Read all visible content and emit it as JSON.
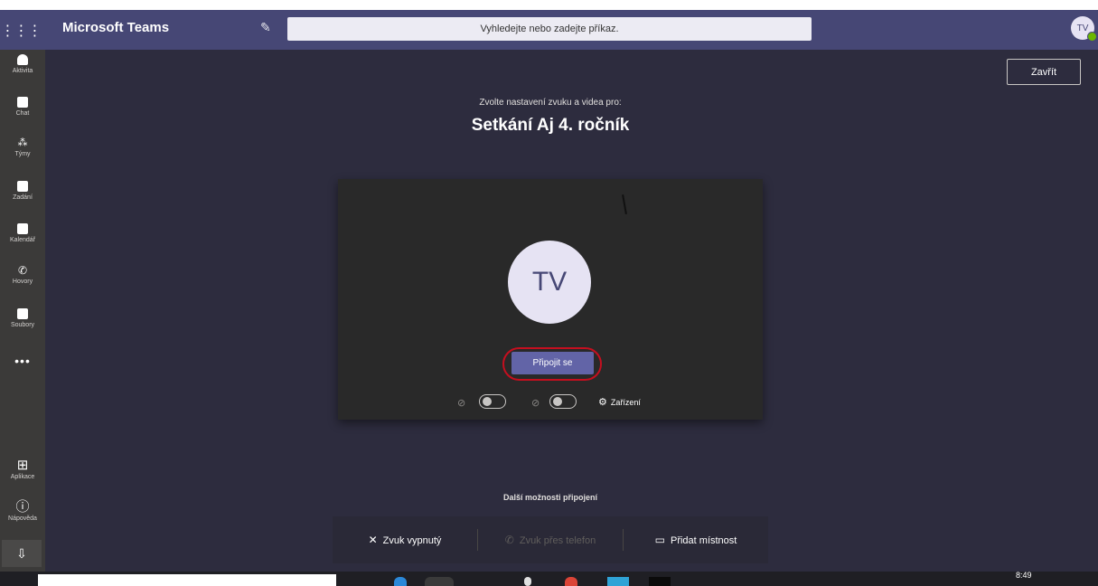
{
  "app_bar": {
    "title": "Microsoft Teams",
    "search_placeholder": "Vyhledejte nebo zadejte příkaz.",
    "avatar_initials": "TV",
    "launcher_icon": "grid-icon",
    "compose_icon": "compose-icon",
    "accent": "#464775"
  },
  "rail": {
    "items": [
      {
        "label": "Aktivita",
        "icon": "bell-icon"
      },
      {
        "label": "Chat",
        "icon": "chat-icon"
      },
      {
        "label": "Týmy",
        "icon": "teams-icon"
      },
      {
        "label": "Zadání",
        "icon": "assignments-icon"
      },
      {
        "label": "Kalendář",
        "icon": "calendar-icon"
      },
      {
        "label": "Hovory",
        "icon": "phone-icon"
      },
      {
        "label": "Soubory",
        "icon": "files-icon"
      }
    ],
    "more": "•••",
    "apps_label": "Aplikace",
    "help_label": "Nápověda"
  },
  "main": {
    "close_label": "Zavřít",
    "subtitle": "Zvolte nastavení zvuku a videa pro:",
    "meeting_title": "Setkání Aj 4. ročník",
    "avatar_initials": "TV",
    "join_label": "Připojit se",
    "devices_label": "Zařízení",
    "video_on": false,
    "mic_on": false,
    "join_color": "#6264a7",
    "highlight_color": "#c50f1f"
  },
  "join_options": {
    "heading": "Další možnosti připojení",
    "items": [
      {
        "label": "Zvuk vypnutý",
        "enabled": true,
        "icon": "speaker-off-icon"
      },
      {
        "label": "Zvuk přes telefon",
        "enabled": false,
        "icon": "phone-icon"
      },
      {
        "label": "Přidat místnost",
        "enabled": true,
        "icon": "room-icon"
      }
    ]
  },
  "taskbar": {
    "time": "8:49"
  }
}
